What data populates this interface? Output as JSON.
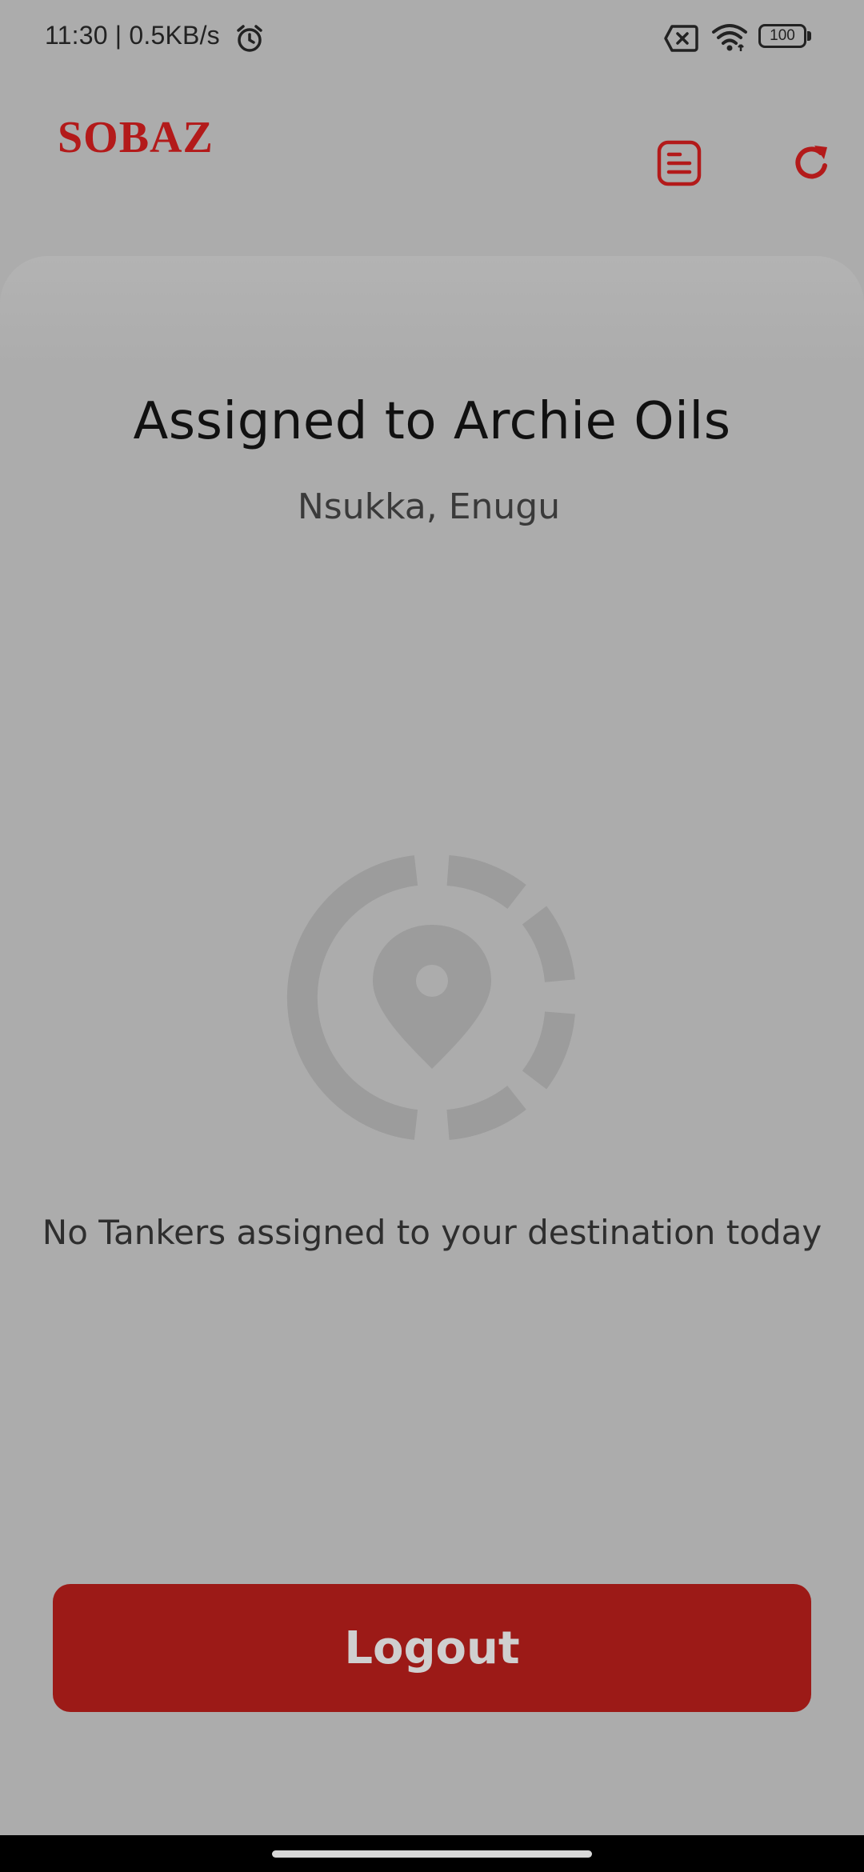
{
  "status_bar": {
    "time_speed": "11:30 | 0.5KB/s",
    "battery_level": "100",
    "icons": [
      "alarm-icon",
      "sim-off-icon",
      "wifi-icon",
      "battery-icon"
    ]
  },
  "header": {
    "logo_text": "SOBAZ",
    "icons": [
      "document-list-icon",
      "refresh-icon"
    ],
    "accent_color": "#b31a1a"
  },
  "main": {
    "title": "Assigned to Archie Oils",
    "location": "Nsukka, Enugu",
    "empty_icon": "location-pin-target-icon",
    "empty_message": "No Tankers assigned to your destination today"
  },
  "footer": {
    "logout_label": "Logout",
    "button_color": "#9c1a17"
  }
}
